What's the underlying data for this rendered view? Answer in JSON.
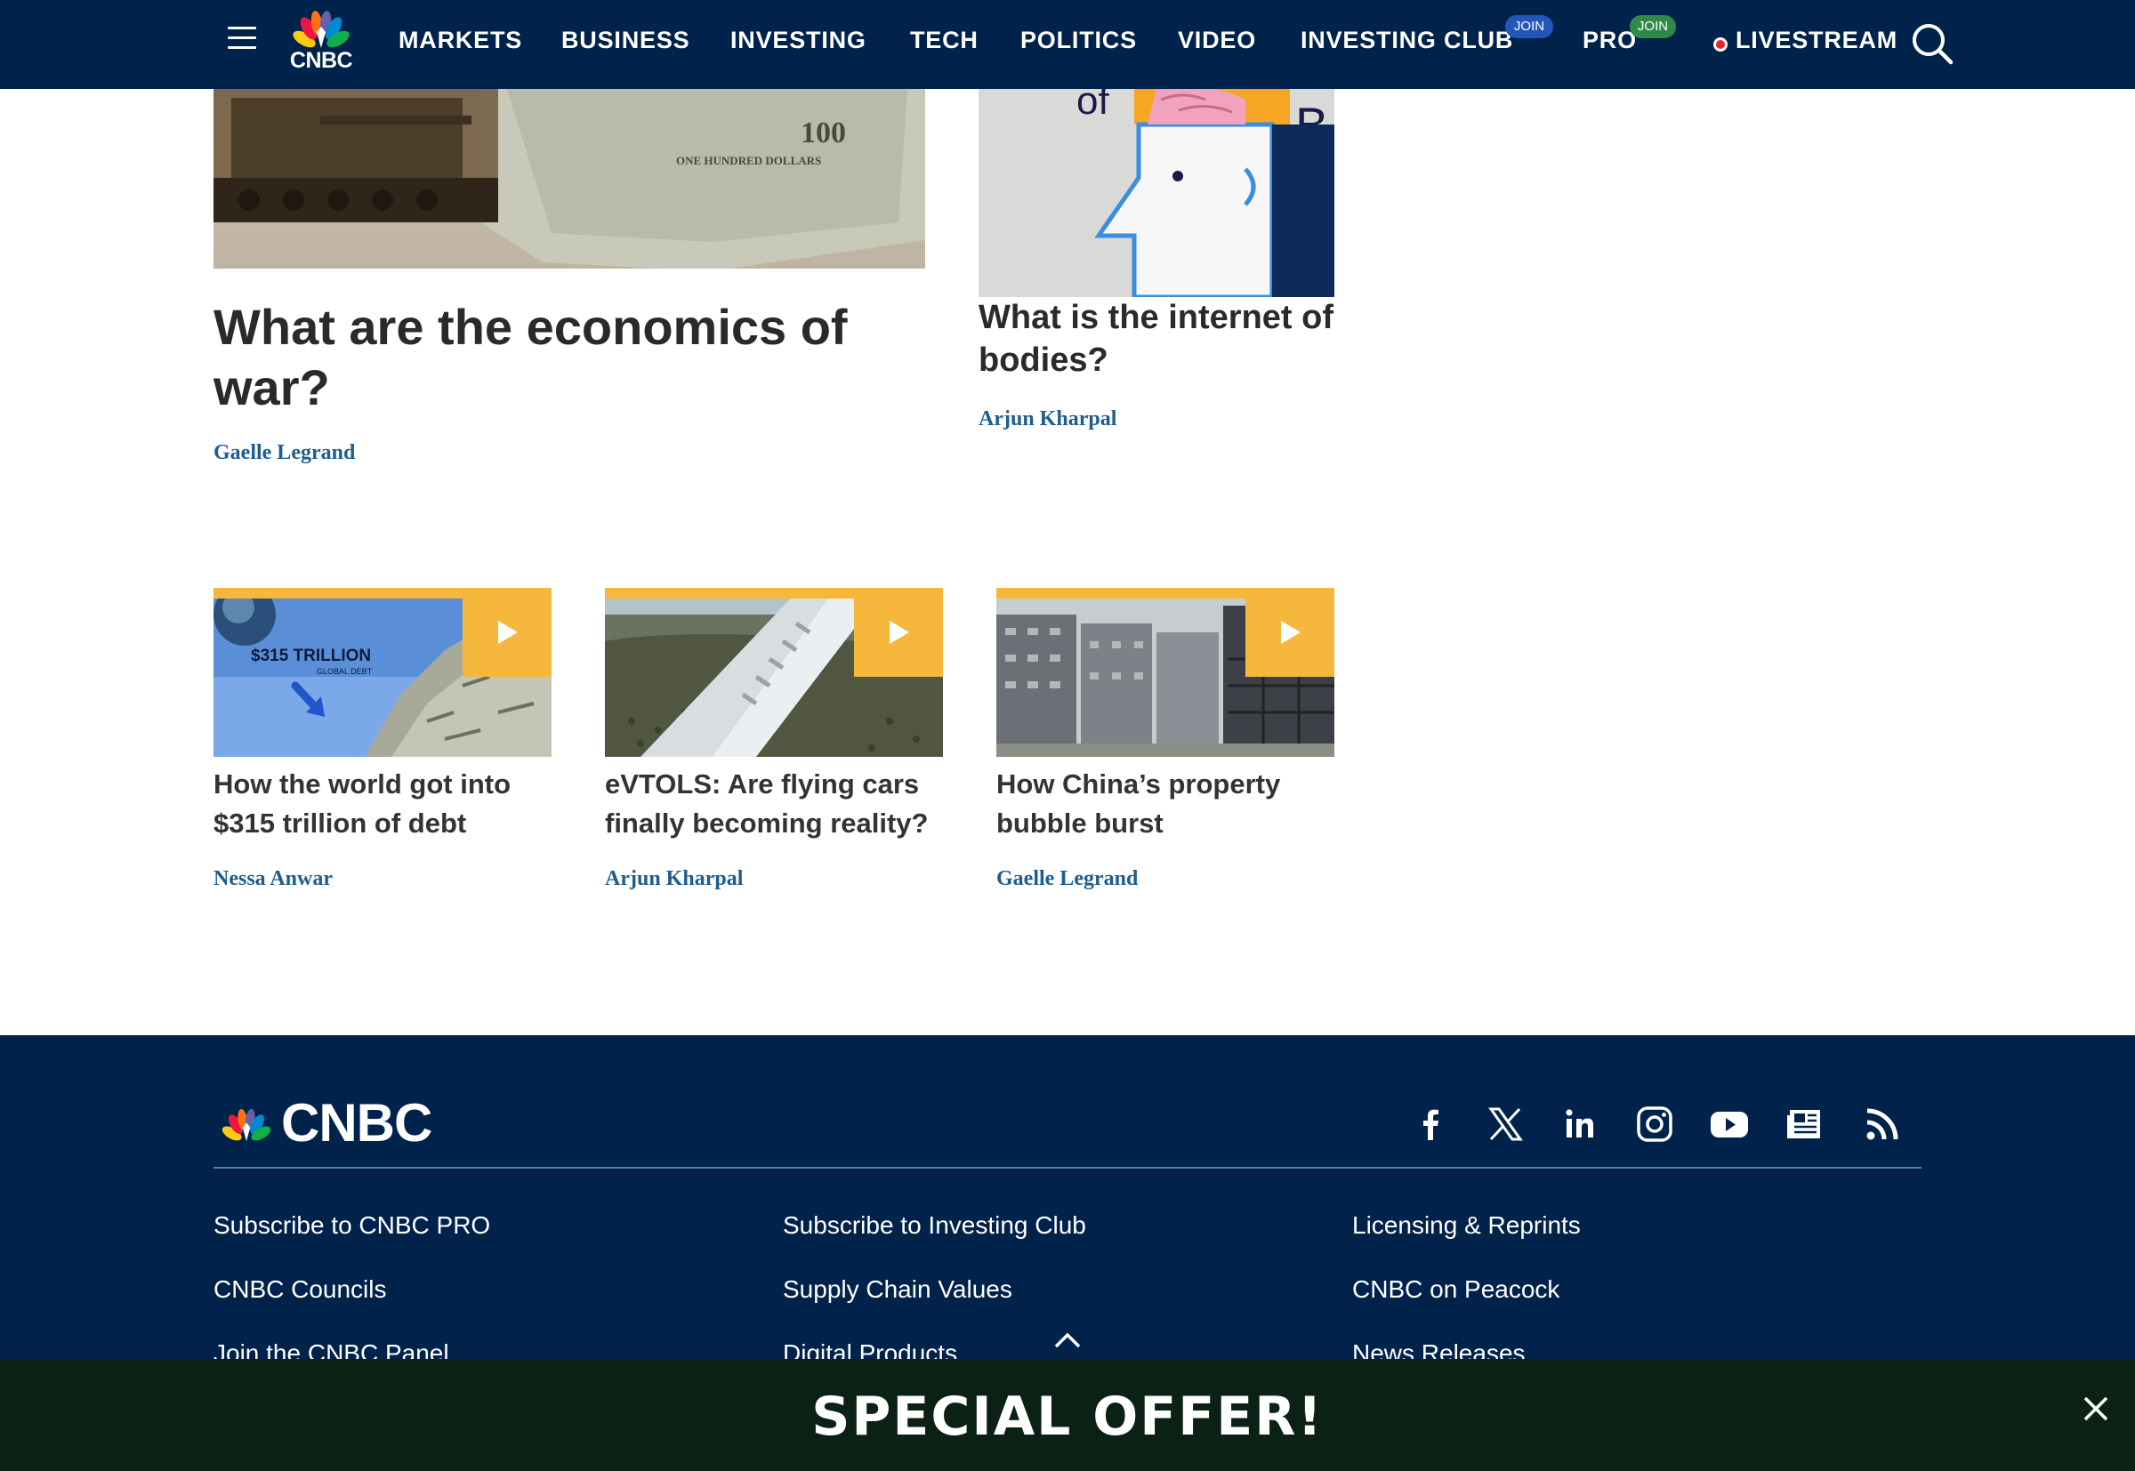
{
  "header": {
    "logo_text": "CNBC",
    "nav": [
      {
        "label": "MARKETS"
      },
      {
        "label": "BUSINESS"
      },
      {
        "label": "INVESTING"
      },
      {
        "label": "TECH"
      },
      {
        "label": "POLITICS"
      },
      {
        "label": "VIDEO"
      },
      {
        "label": "INVESTING CLUB",
        "badge": "JOIN"
      },
      {
        "label": "PRO",
        "badge": "JOIN"
      },
      {
        "label": "LIVESTREAM"
      }
    ],
    "colors": {
      "background": "#00224b",
      "club_badge": "#2455b8",
      "pro_badge": "#2e8b47",
      "live_dot": "#e5282c"
    }
  },
  "featured": [
    {
      "headline": "What are the economics of war?",
      "author": "Gaelle Legrand",
      "image_text": "ONE HUNDRED DOLLARS"
    },
    {
      "headline": "What is the internet of bodies?",
      "author": "Arjun Kharpal"
    }
  ],
  "videos": [
    {
      "headline": "How the world got into $315 trillion of debt",
      "author": "Nessa Anwar",
      "image_caption": "$315 TRILLION",
      "image_subcaption": "GLOBAL DEBT"
    },
    {
      "headline": "eVTOLS: Are flying cars finally becoming reality?",
      "author": "Arjun Kharpal"
    },
    {
      "headline": "How China’s property bubble burst",
      "author": "Gaelle Legrand"
    }
  ],
  "footer": {
    "logo_text": "CNBC",
    "social": [
      "facebook-icon",
      "x-icon",
      "linkedin-icon",
      "instagram-icon",
      "youtube-icon",
      "news-icon",
      "rss-icon"
    ],
    "links": [
      [
        "Subscribe to CNBC PRO",
        "CNBC Councils",
        "Join the CNBC Panel"
      ],
      [
        "Subscribe to Investing Club",
        "Supply Chain Values",
        "Digital Products"
      ],
      [
        "Licensing & Reprints",
        "CNBC on Peacock",
        "News Releases"
      ]
    ]
  },
  "offer": {
    "text": "SPECIAL OFFER!"
  },
  "colors": {
    "accent": "#f5b83c",
    "author": "#1d5d8f",
    "footer_bg": "#00224b",
    "offer_bg": "#0b2116"
  }
}
